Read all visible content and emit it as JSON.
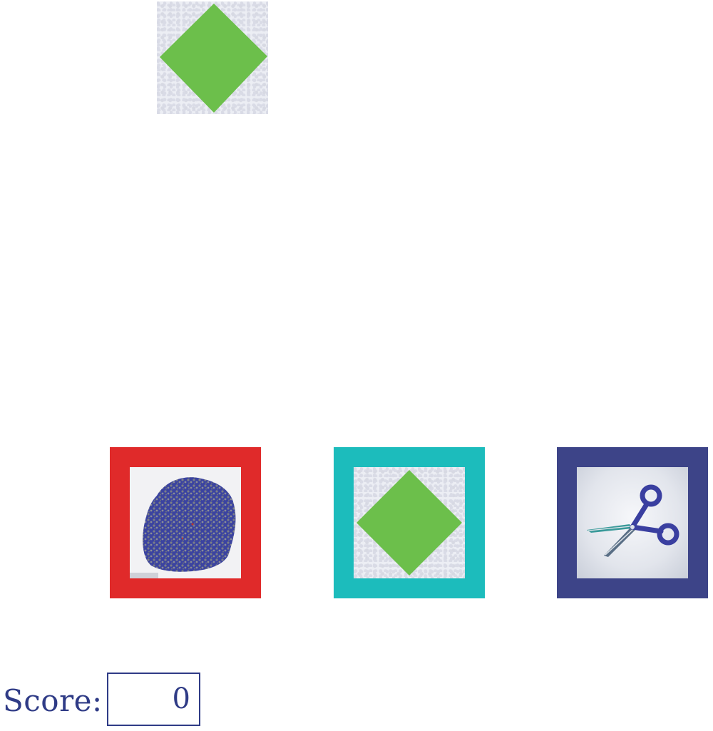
{
  "game": {
    "falling_item": {
      "kind": "paper",
      "icon": "green-diamond-icon"
    },
    "choices": [
      {
        "kind": "rock",
        "icon": "rock-icon",
        "border_color": "#e02a2a"
      },
      {
        "kind": "paper",
        "icon": "green-diamond-icon",
        "border_color": "#1cbcbc"
      },
      {
        "kind": "scissors",
        "icon": "scissors-icon",
        "border_color": "#3d4488"
      }
    ]
  },
  "score": {
    "label": "Score:",
    "value": "0"
  },
  "colors": {
    "diamond_green": "#6cbf4b",
    "text_navy": "#2f3b86",
    "rock_blue": "#3b43a0",
    "rock_grey": "#7c7f88"
  }
}
